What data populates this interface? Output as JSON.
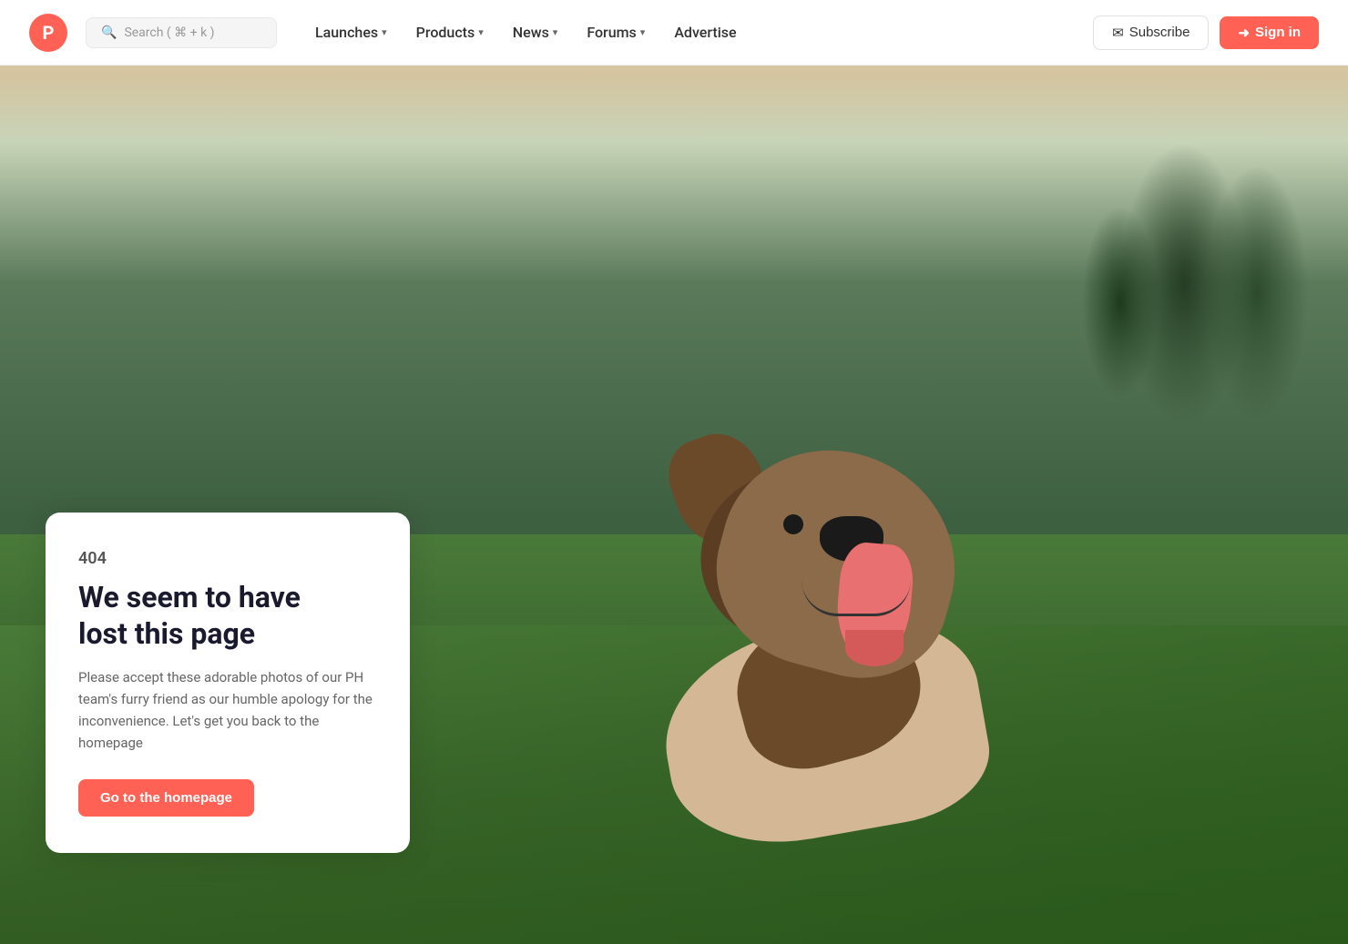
{
  "site": {
    "logo_letter": "P",
    "logo_color": "#ff6154"
  },
  "navbar": {
    "search_placeholder": "Search ( ⌘ + k )",
    "nav_items": [
      {
        "label": "Launches",
        "has_dropdown": true
      },
      {
        "label": "Products",
        "has_dropdown": true
      },
      {
        "label": "News",
        "has_dropdown": true
      },
      {
        "label": "Forums",
        "has_dropdown": true
      },
      {
        "label": "Advertise",
        "has_dropdown": false
      }
    ],
    "subscribe_label": "Subscribe",
    "signin_label": "Sign in"
  },
  "error_page": {
    "error_code": "404",
    "title_line1": "We seem to have",
    "title_line2": "lost this page",
    "description": "Please accept these adorable photos of our PH team's furry friend as our humble apology for the inconvenience. Let's get you back to the homepage",
    "cta_label": "Go to the homepage"
  }
}
